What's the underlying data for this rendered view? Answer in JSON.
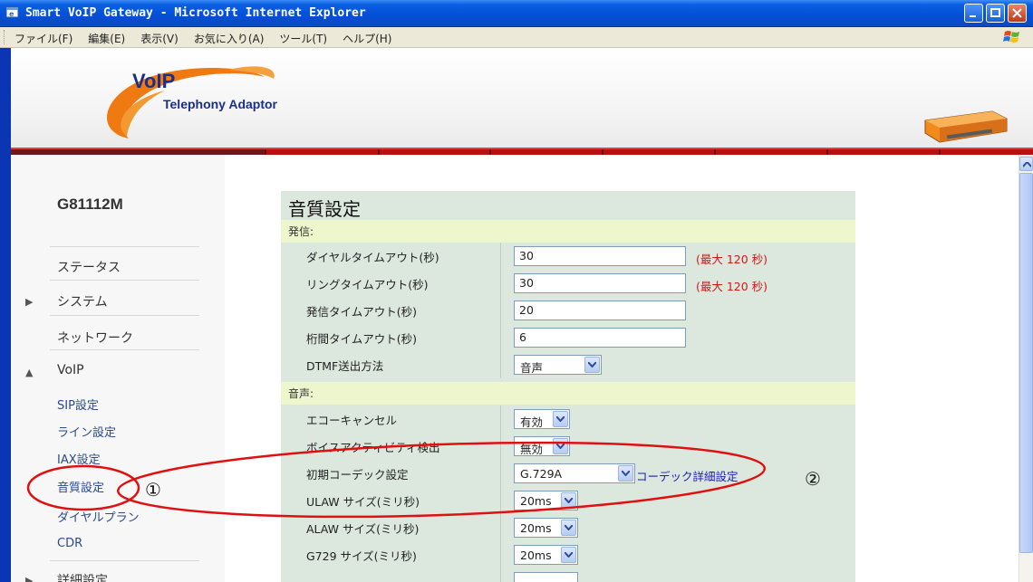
{
  "window": {
    "title": "Smart VoIP Gateway - Microsoft Internet Explorer"
  },
  "menu": [
    "ファイル(F)",
    "編集(E)",
    "表示(V)",
    "お気に入り(A)",
    "ツール(T)",
    "ヘルプ(H)"
  ],
  "banner": {
    "logo_main": "VoIP",
    "logo_sub": "Telephony Adaptor"
  },
  "sidebar": {
    "device_name": "G81112M",
    "items": [
      {
        "label": "ステータス",
        "arrow": ""
      },
      {
        "label": "システム",
        "arrow": "▶"
      },
      {
        "label": "ネットワーク",
        "arrow": ""
      },
      {
        "label": "VoIP",
        "arrow": "▲"
      }
    ],
    "sub_items": [
      "SIP設定",
      "ライン設定",
      "IAX設定",
      "音質設定",
      "ダイヤルプラン",
      "CDR"
    ],
    "more_item": {
      "label": "詳細設定",
      "arrow": "▶"
    }
  },
  "panel": {
    "title": "音質設定",
    "section_outgoing": "発信:",
    "outgoing_rows": [
      {
        "label": "ダイヤルタイムアウト(秒)",
        "value": "30",
        "note": "(最大 120 秒)"
      },
      {
        "label": "リングタイムアウト(秒)",
        "value": "30",
        "note": "(最大 120 秒)"
      },
      {
        "label": "発信タイムアウト(秒)",
        "value": "20",
        "note": ""
      },
      {
        "label": "桁間タイムアウト(秒)",
        "value": "6",
        "note": ""
      }
    ],
    "dtmf": {
      "label": "DTMF送出方法",
      "value": "音声"
    },
    "section_voice": "音声:",
    "voice_rows": [
      {
        "label": "エコーキャンセル",
        "value": "有効"
      },
      {
        "label": "ボイスアクティビティ検出",
        "value": "無効"
      },
      {
        "label": "初期コーデック設定",
        "value": "G.729A"
      },
      {
        "label": "ULAW サイズ(ミリ秒)",
        "value": "20ms"
      },
      {
        "label": "ALAW サイズ(ミリ秒)",
        "value": "20ms"
      },
      {
        "label": "G729 サイズ(ミリ秒)",
        "value": "20ms"
      }
    ],
    "codec_link": "コーデック詳細設定"
  },
  "annotations": {
    "marker1": "①",
    "marker2": "②",
    "color": "#e01010"
  }
}
